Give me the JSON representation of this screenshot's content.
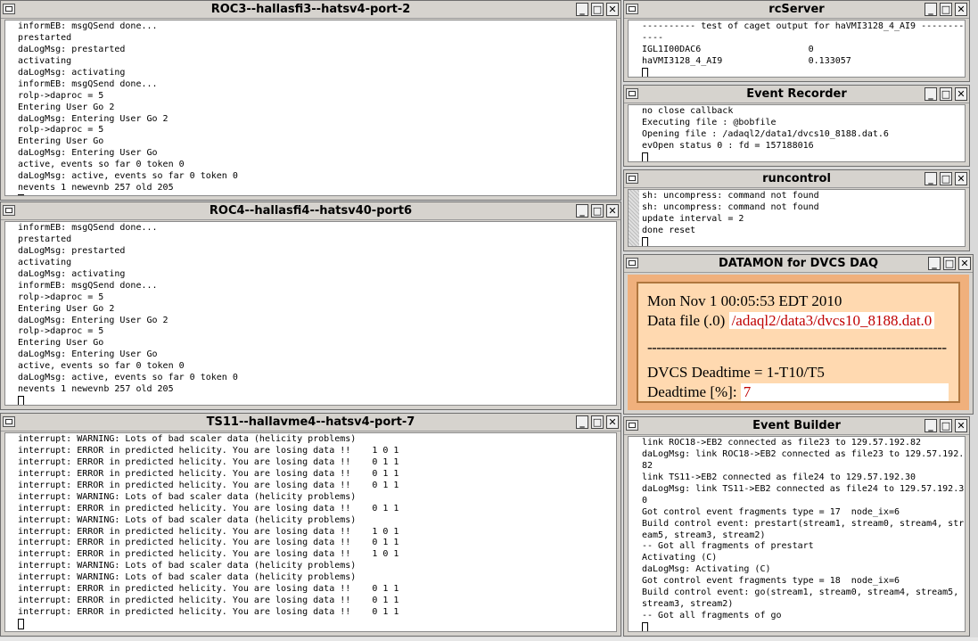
{
  "windows": {
    "roc3": {
      "title": "ROC3--hallasfi3--hatsv4-port-2",
      "lines": [
        "informEB: msgQSend done...",
        "prestarted",
        "daLogMsg: prestarted",
        "activating",
        "daLogMsg: activating",
        "informEB: msgQSend done...",
        "rolp->daproc = 5",
        "Entering User Go 2",
        "daLogMsg: Entering User Go 2",
        "rolp->daproc = 5",
        "Entering User Go",
        "daLogMsg: Entering User Go",
        "active, events so far 0 token 0",
        "daLogMsg: active, events so far 0 token 0",
        "nevents 1 newevnb 257 old 205"
      ]
    },
    "roc4": {
      "title": "ROC4--hallasfi4--hatsv40-port6",
      "lines": [
        "informEB: msgQSend done...",
        "prestarted",
        "daLogMsg: prestarted",
        "activating",
        "daLogMsg: activating",
        "informEB: msgQSend done...",
        "rolp->daproc = 5",
        "Entering User Go 2",
        "daLogMsg: Entering User Go 2",
        "rolp->daproc = 5",
        "Entering User Go",
        "daLogMsg: Entering User Go",
        "active, events so far 0 token 0",
        "daLogMsg: active, events so far 0 token 0",
        "nevents 1 newevnb 257 old 205"
      ]
    },
    "ts11": {
      "title": "TS11--hallavme4--hatsv4-port-7",
      "lines": [
        "interrupt: WARNING: Lots of bad scaler data (helicity problems)",
        "interrupt: ERROR in predicted helicity. You are losing data !!    1 0 1",
        "interrupt: ERROR in predicted helicity. You are losing data !!    0 1 1",
        "interrupt: ERROR in predicted helicity. You are losing data !!    0 1 1",
        "interrupt: ERROR in predicted helicity. You are losing data !!    0 1 1",
        "interrupt: WARNING: Lots of bad scaler data (helicity problems)",
        "interrupt: ERROR in predicted helicity. You are losing data !!    0 1 1",
        "interrupt: WARNING: Lots of bad scaler data (helicity problems)",
        "interrupt: ERROR in predicted helicity. You are losing data !!    1 0 1",
        "interrupt: ERROR in predicted helicity. You are losing data !!    0 1 1",
        "interrupt: ERROR in predicted helicity. You are losing data !!    1 0 1",
        "interrupt: WARNING: Lots of bad scaler data (helicity problems)",
        "interrupt: WARNING: Lots of bad scaler data (helicity problems)",
        "interrupt: ERROR in predicted helicity. You are losing data !!    0 1 1",
        "interrupt: ERROR in predicted helicity. You are losing data !!    0 1 1",
        "interrupt: ERROR in predicted helicity. You are losing data !!    0 1 1"
      ]
    },
    "rcserver": {
      "title": "rcServer",
      "lines": [
        "---------- test of caget output for haVMI3128_4_AI9 ---------",
        "----",
        "IGL1I00DAC6                    0",
        "haVMI3128_4_AI9                0.133057"
      ]
    },
    "eventrecorder": {
      "title": "Event Recorder",
      "lines": [
        "no close callback",
        "Executing file : @bobfile",
        "Opening file : /adaql2/data1/dvcs10_8188.dat.6",
        "evOpen status 0 : fd = 157188016"
      ]
    },
    "runcontrol": {
      "title": "runcontrol",
      "lines": [
        "sh: uncompress: command not found",
        "sh: uncompress: command not found",
        "update interval = 2",
        "done reset"
      ]
    },
    "datamon": {
      "title": "DATAMON  for DVCS DAQ",
      "datetime": "Mon Nov  1 00:05:53 EDT 2010",
      "datafile_label": "Data file (.0)",
      "datafile_value": "/adaql2/data3/dvcs10_8188.dat.0",
      "separator": "-----------------------------------------------------------------",
      "deadtime_formula": "DVCS Deadtime = 1-T10/T5",
      "deadtime_label": "Deadtime [%]:",
      "deadtime_value": "7"
    },
    "eventbuilder": {
      "title": "Event Builder",
      "lines": [
        "link ROC18->EB2 connected as file23 to 129.57.192.82",
        "daLogMsg: link ROC18->EB2 connected as file23 to 129.57.192.",
        "82",
        "link TS11->EB2 connected as file24 to 129.57.192.30",
        "daLogMsg: link TS11->EB2 connected as file24 to 129.57.192.3",
        "0",
        "Got control event fragments type = 17  node_ix=6",
        "Build control event: prestart(stream1, stream0, stream4, str",
        "eam5, stream3, stream2)",
        "-- Got all fragments of prestart",
        "Activating (C)",
        "daLogMsg: Activating (C)",
        "Got control event fragments type = 18  node_ix=6",
        "Build control event: go(stream1, stream0, stream4, stream5,",
        "stream3, stream2)",
        "-- Got all fragments of go"
      ]
    }
  },
  "controls": {
    "minimize": "_",
    "maximize": "□",
    "close": "✕"
  }
}
